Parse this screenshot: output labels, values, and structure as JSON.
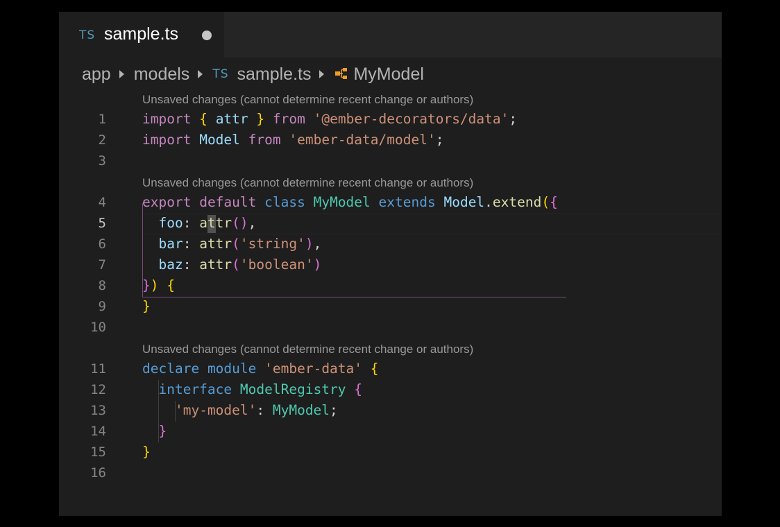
{
  "tab": {
    "lang_badge": "TS",
    "file_name": "sample.ts"
  },
  "breadcrumbs": [
    "app",
    "models",
    "sample.ts",
    "MyModel"
  ],
  "breadcrumb_ts_badge": "TS",
  "codelens": "Unsaved changes (cannot determine recent change or authors)",
  "active_line": 5,
  "icons": {
    "tab": "typescript-file-icon",
    "dirty": "unsaved-dot-icon",
    "separator": "chevron-right-icon",
    "class": "class-symbol-icon"
  },
  "colors": {
    "background": "#1e1e1e",
    "keyword": "#c586c0",
    "storage": "#569cd6",
    "string": "#ce9178",
    "type": "#4ec9b0",
    "variable": "#9cdcfe",
    "function": "#dcdcaa"
  },
  "lines": [
    {
      "n": "1",
      "tokens": [
        [
          "import",
          "k"
        ],
        [
          " ",
          "w"
        ],
        [
          "{",
          "y"
        ],
        [
          " attr ",
          "v"
        ],
        [
          "}",
          "y"
        ],
        [
          " ",
          "w"
        ],
        [
          "from",
          "k"
        ],
        [
          " ",
          "w"
        ],
        [
          "'@ember-decorators/data'",
          "s"
        ],
        [
          ";",
          "w"
        ]
      ]
    },
    {
      "n": "2",
      "tokens": [
        [
          "import",
          "k"
        ],
        [
          " ",
          "w"
        ],
        [
          "Model",
          "v"
        ],
        [
          " ",
          "w"
        ],
        [
          "from",
          "k"
        ],
        [
          " ",
          "w"
        ],
        [
          "'ember-data/model'",
          "s"
        ],
        [
          ";",
          "w"
        ]
      ]
    },
    {
      "n": "3",
      "tokens": []
    },
    {
      "n": "4",
      "tokens": [
        [
          "export",
          "k"
        ],
        [
          " ",
          "w"
        ],
        [
          "default",
          "k"
        ],
        [
          " ",
          "w"
        ],
        [
          "class",
          "b"
        ],
        [
          " ",
          "w"
        ],
        [
          "MyModel",
          "t"
        ],
        [
          " ",
          "w"
        ],
        [
          "extends",
          "b"
        ],
        [
          " ",
          "w"
        ],
        [
          "Model",
          "v"
        ],
        [
          ".",
          "w"
        ],
        [
          "extend",
          "f"
        ],
        [
          "(",
          "y"
        ],
        [
          "{",
          "p"
        ]
      ]
    },
    {
      "n": "5",
      "tokens": [
        [
          "  ",
          "w"
        ],
        [
          "foo",
          "v"
        ],
        [
          ": ",
          "w"
        ],
        [
          "attr",
          "f"
        ],
        [
          "()",
          "p"
        ],
        [
          ",",
          "w"
        ]
      ]
    },
    {
      "n": "6",
      "tokens": [
        [
          "  ",
          "w"
        ],
        [
          "bar",
          "v"
        ],
        [
          ": ",
          "w"
        ],
        [
          "attr",
          "f"
        ],
        [
          "(",
          "p"
        ],
        [
          "'string'",
          "s"
        ],
        [
          ")",
          "p"
        ],
        [
          ",",
          "w"
        ]
      ]
    },
    {
      "n": "7",
      "tokens": [
        [
          "  ",
          "w"
        ],
        [
          "baz",
          "v"
        ],
        [
          ": ",
          "w"
        ],
        [
          "attr",
          "f"
        ],
        [
          "(",
          "p"
        ],
        [
          "'boolean'",
          "s"
        ],
        [
          ")",
          "p"
        ]
      ]
    },
    {
      "n": "8",
      "tokens": [
        [
          "}",
          "p"
        ],
        [
          ")",
          "y"
        ],
        [
          " ",
          "w"
        ],
        [
          "{",
          "y"
        ]
      ]
    },
    {
      "n": "9",
      "tokens": [
        [
          "}",
          "y"
        ]
      ]
    },
    {
      "n": "10",
      "tokens": []
    },
    {
      "n": "11",
      "tokens": [
        [
          "declare",
          "b"
        ],
        [
          " ",
          "w"
        ],
        [
          "module",
          "b"
        ],
        [
          " ",
          "w"
        ],
        [
          "'ember-data'",
          "s"
        ],
        [
          " ",
          "w"
        ],
        [
          "{",
          "y"
        ]
      ]
    },
    {
      "n": "12",
      "tokens": [
        [
          "  ",
          "w"
        ],
        [
          "interface",
          "b"
        ],
        [
          " ",
          "w"
        ],
        [
          "ModelRegistry",
          "t"
        ],
        [
          " ",
          "w"
        ],
        [
          "{",
          "p"
        ]
      ]
    },
    {
      "n": "13",
      "tokens": [
        [
          "    ",
          "w"
        ],
        [
          "'my-model'",
          "s"
        ],
        [
          ": ",
          "w"
        ],
        [
          "MyModel",
          "t"
        ],
        [
          ";",
          "w"
        ]
      ]
    },
    {
      "n": "14",
      "tokens": [
        [
          "  ",
          "w"
        ],
        [
          "}",
          "p"
        ]
      ]
    },
    {
      "n": "15",
      "tokens": [
        [
          "}",
          "y"
        ]
      ]
    },
    {
      "n": "16",
      "tokens": []
    }
  ]
}
